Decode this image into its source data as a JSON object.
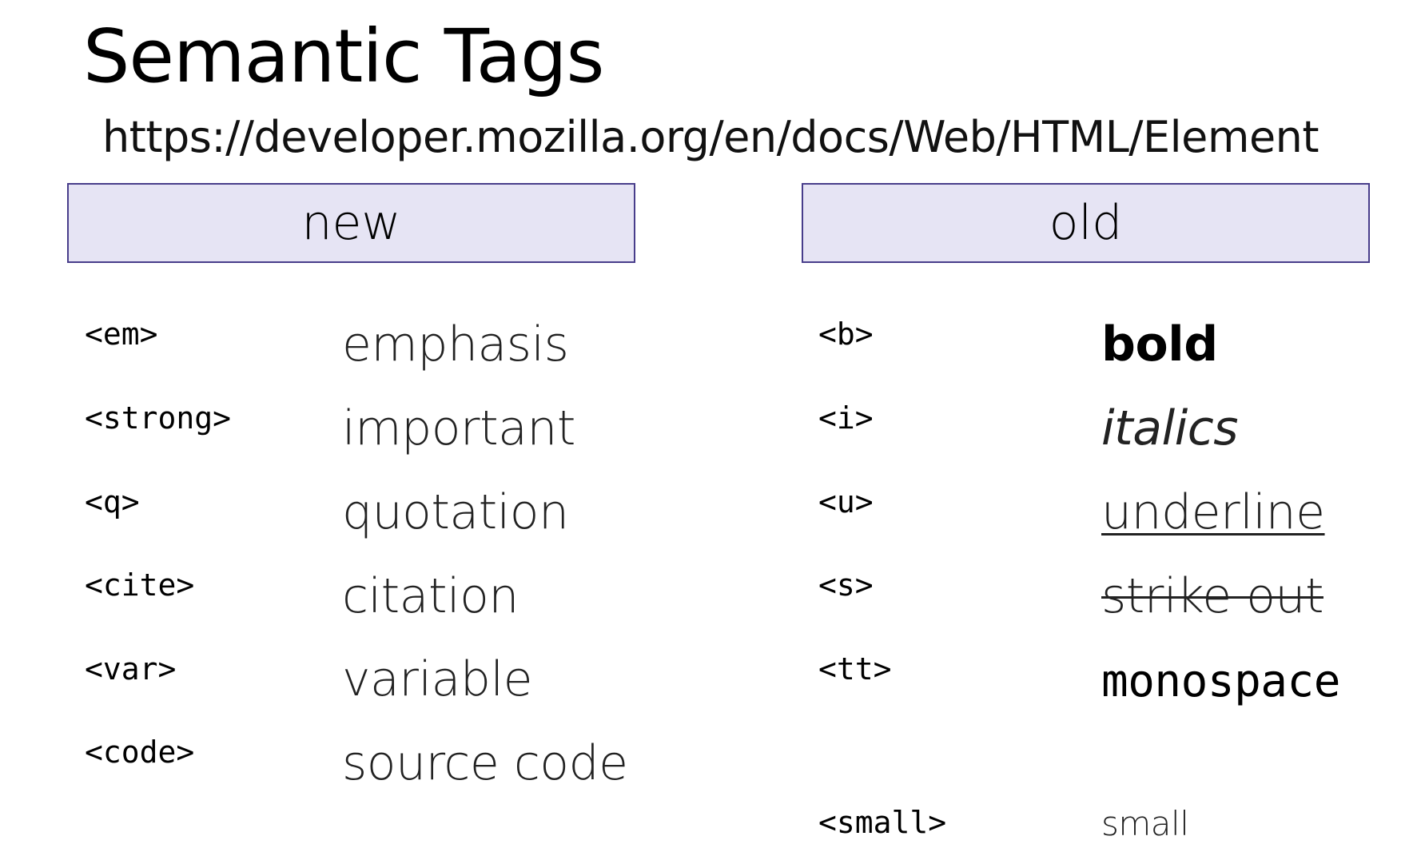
{
  "page": {
    "title": "Semantic Tags",
    "url": "https://developer.mozilla.org/en/docs/Web/HTML/Element"
  },
  "columns": {
    "new": {
      "header": "new",
      "rows": [
        {
          "tag": "<em>",
          "desc": "emphasis"
        },
        {
          "tag": "<strong>",
          "desc": "important"
        },
        {
          "tag": "<q>",
          "desc": "quotation"
        },
        {
          "tag": "<cite>",
          "desc": "citation"
        },
        {
          "tag": "<var>",
          "desc": "variable"
        },
        {
          "tag": "<code>",
          "desc": "source code"
        }
      ]
    },
    "old": {
      "header": "old",
      "rows": [
        {
          "tag": "<b>",
          "desc": "bold"
        },
        {
          "tag": "<i>",
          "desc": "italics"
        },
        {
          "tag": "<u>",
          "desc": "underline"
        },
        {
          "tag": "<s>",
          "desc": "strike out"
        },
        {
          "tag": "<tt>",
          "desc": "monospace"
        },
        {
          "tag": "<small>",
          "desc": "small"
        }
      ]
    }
  },
  "colors": {
    "header_fill": "#e6e4f4",
    "header_border": "#483d8b"
  }
}
